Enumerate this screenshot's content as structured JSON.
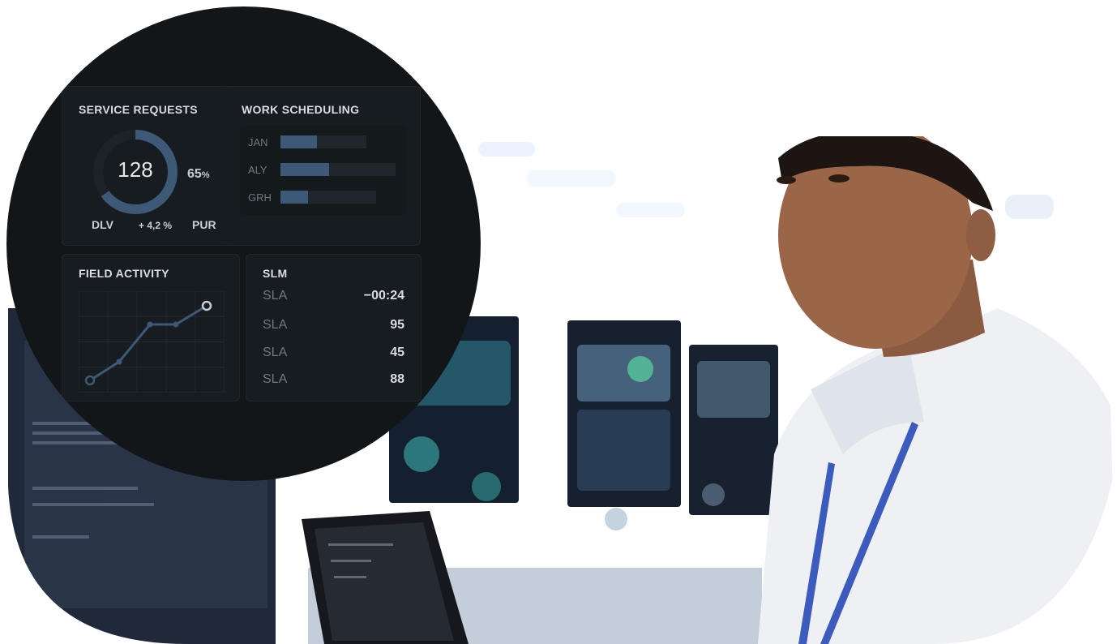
{
  "dashboard": {
    "service_requests": {
      "title": "SERVICE REQUESTS",
      "count": "128",
      "percent": "65",
      "percent_unit": "%",
      "left_label": "DLV",
      "delta": "+ 4,2 %",
      "right_label": "PUR",
      "donut_fill_fraction": 0.65
    },
    "work_scheduling": {
      "title": "WORK SCHEDULING",
      "rows": [
        {
          "label": "JAN",
          "fill": 0.42
        },
        {
          "label": "ALY",
          "fill": 0.42
        },
        {
          "label": "GRH",
          "fill": 0.29
        }
      ]
    },
    "field_activity": {
      "title": "FIELD ACTIVITY",
      "points": [
        1,
        2,
        4,
        4,
        5
      ]
    },
    "slm": {
      "title": "SLM",
      "rows": [
        {
          "label": "SLA",
          "value": "−00:24"
        },
        {
          "label": "SLA",
          "value": "95"
        },
        {
          "label": "SLA",
          "value": "45"
        },
        {
          "label": "SLA",
          "value": "88"
        }
      ]
    }
  },
  "colors": {
    "accent": "#3e5877",
    "disc_bg": "#121619",
    "card_bg": "#171c20",
    "lanyard": "#3b5bbd"
  }
}
